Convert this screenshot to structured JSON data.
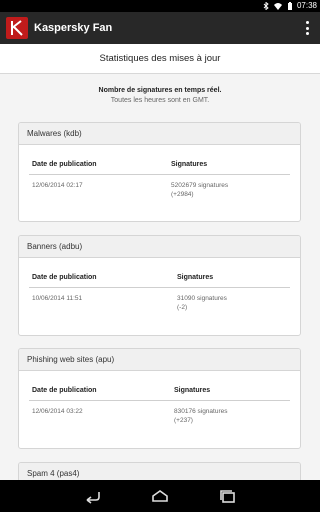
{
  "status_bar": {
    "time": "07:38",
    "icons": [
      "bluetooth-icon",
      "wifi-icon",
      "battery-icon"
    ]
  },
  "app_bar": {
    "title": "Kaspersky Fan",
    "logo_icon": "kaspersky-logo-icon",
    "menu_icon": "overflow-menu-icon"
  },
  "page": {
    "title": "Statistiques des mises à jour",
    "intro_bold": "Nombre de signatures en temps réel.",
    "intro_note": "Toutes les heures sont en GMT."
  },
  "table_headers": {
    "date": "Date de publication",
    "signatures": "Signatures"
  },
  "cards": [
    {
      "title": "Malwares (kdb)",
      "date": "12/06/2014 02:17",
      "signatures": "5202679 signatures",
      "delta": "(+2984)"
    },
    {
      "title": "Banners (adbu)",
      "date": "10/06/2014 11:51",
      "signatures": "31090 signatures",
      "delta": "(-2)"
    },
    {
      "title": "Phishing web sites (apu)",
      "date": "12/06/2014 03:22",
      "signatures": "830176 signatures",
      "delta": "(+237)"
    },
    {
      "title": "Spam 4 (pas4)"
    }
  ],
  "nav": {
    "back_icon": "back-icon",
    "home_icon": "home-icon",
    "recents_icon": "recent-apps-icon"
  },
  "colors": {
    "brand": "#c01b1b",
    "app_bar": "#282828",
    "background": "#f4f4f4"
  }
}
